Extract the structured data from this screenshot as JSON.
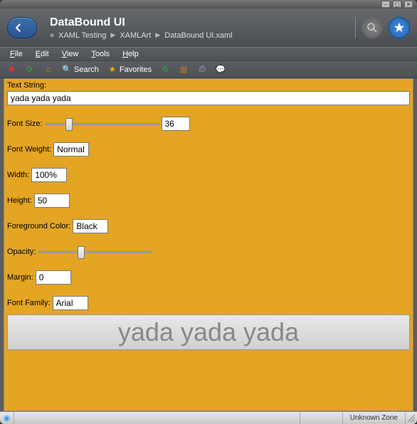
{
  "titlebar": {
    "min": "–",
    "max": "▢",
    "close": "✕"
  },
  "header": {
    "title": "DataBound UI",
    "breadcrumb": [
      "XAML Testing",
      "XAMLArt",
      "DataBound UI.xaml"
    ],
    "chevrons": "«"
  },
  "menu": {
    "file": "File",
    "edit": "Edit",
    "view": "View",
    "tools": "Tools",
    "help": "Help"
  },
  "toolbar": {
    "search": "Search",
    "favorites": "Favorites"
  },
  "form": {
    "text_string_label": "Text String:",
    "text_string_value": "yada yada yada",
    "font_size_label": "Font Size:",
    "font_size_value": "36",
    "font_weight_label": "Font Weight:",
    "font_weight_value": "Normal",
    "width_label": "Width:",
    "width_value": "100%",
    "height_label": "Height:",
    "height_value": "50",
    "foreground_label": "Foreground Color:",
    "foreground_value": "Black",
    "opacity_label": "Opacity:",
    "margin_label": "Margin:",
    "margin_value": "0",
    "font_family_label": "Font Family:",
    "font_family_value": "Arial"
  },
  "preview_text": "yada yada yada",
  "statusbar": {
    "zone": "Unknown Zone"
  },
  "colors": {
    "content_bg": "#e3a522",
    "accent": "#2a6fc0"
  }
}
